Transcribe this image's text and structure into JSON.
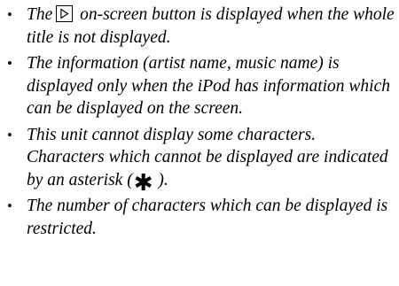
{
  "notes": [
    {
      "bullet": "•",
      "before": "The",
      "icon": "play-button-icon",
      "after": " on-screen button is displayed when the whole title is not displayed."
    },
    {
      "bullet": "•",
      "text": "The information (artist name, music name) is displayed only when the iPod has information which can be displayed on the screen."
    },
    {
      "bullet": "•",
      "before": "This unit cannot display some characters. Characters which cannot be displayed are indicated by an asterisk (",
      "icon_char": "✱",
      "after": " )."
    },
    {
      "bullet": "•",
      "text": "The number of characters which can be displayed is restricted."
    }
  ]
}
